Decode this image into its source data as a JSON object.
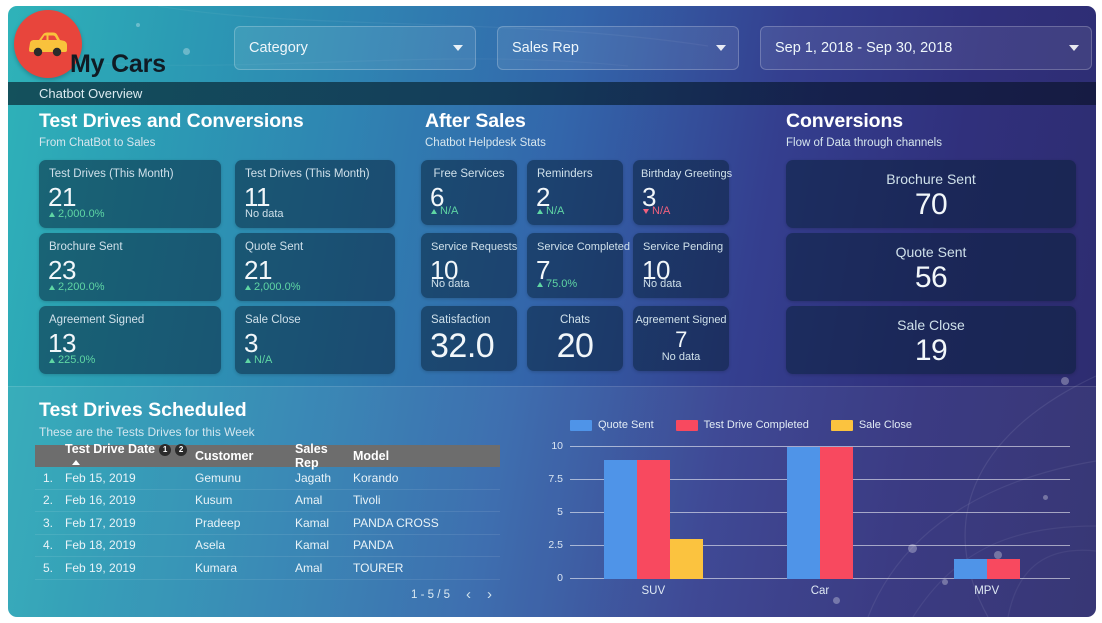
{
  "header": {
    "brand": "My Cars",
    "logo_icon": "car-icon",
    "subtitle": "Chatbot Overview",
    "filters": [
      {
        "name": "category",
        "label": "Category"
      },
      {
        "name": "sales-rep",
        "label": "Sales Rep"
      },
      {
        "name": "date-range",
        "label": "Sep 1, 2018 - Sep 30, 2018"
      }
    ]
  },
  "sections": {
    "test_drives": {
      "title": "Test Drives and Conversions",
      "subtitle": "From ChatBot to Sales",
      "cards": [
        {
          "label": "Test Drives (This Month)",
          "value": "21",
          "delta": "2,000.0%",
          "trend": "up"
        },
        {
          "label": "Test Drives (This Month)",
          "value": "11",
          "delta": "No data",
          "trend": "none"
        },
        {
          "label": "Brochure Sent",
          "value": "23",
          "delta": "2,200.0%",
          "trend": "up"
        },
        {
          "label": "Quote Sent",
          "value": "21",
          "delta": "2,000.0%",
          "trend": "up"
        },
        {
          "label": "Agreement Signed",
          "value": "13",
          "delta": "225.0%",
          "trend": "up"
        },
        {
          "label": "Sale Close",
          "value": "3",
          "delta": "N/A",
          "trend": "up"
        }
      ]
    },
    "after_sales": {
      "title": "After Sales",
      "subtitle": "Chatbot Helpdesk Stats",
      "cards": [
        {
          "label": "Free Services",
          "value": "6",
          "delta": "N/A",
          "trend": "up"
        },
        {
          "label": "Reminders",
          "value": "2",
          "delta": "N/A",
          "trend": "up"
        },
        {
          "label": "Birthday Greetings",
          "value": "3",
          "delta": "N/A",
          "trend": "down"
        },
        {
          "label": "Service Requests",
          "value": "10",
          "delta": "No data",
          "trend": "none"
        },
        {
          "label": "Service Completed",
          "value": "7",
          "delta": "75.0%",
          "trend": "up"
        },
        {
          "label": "Service Pending",
          "value": "10",
          "delta": "No data",
          "trend": "none"
        },
        {
          "label": "Satisfaction",
          "value": "32.0",
          "delta": "",
          "trend": "none"
        },
        {
          "label": "Chats",
          "value": "20",
          "delta": "",
          "trend": "none"
        },
        {
          "label": "Agreement Signed",
          "value": "7",
          "delta": "No data",
          "trend": "none"
        }
      ]
    },
    "conversions": {
      "title": "Conversions",
      "subtitle": "Flow of Data through channels",
      "cards": [
        {
          "label": "Brochure Sent",
          "value": "70"
        },
        {
          "label": "Quote Sent",
          "value": "56"
        },
        {
          "label": "Sale Close",
          "value": "19"
        }
      ]
    }
  },
  "bottom": {
    "title": "Test Drives Scheduled",
    "subtitle": "These are the Tests Drives for this Week",
    "table": {
      "columns": [
        "Test Drive Date",
        "Customer",
        "Sales Rep",
        "Model"
      ],
      "header_badges": [
        "1",
        "2"
      ],
      "rows": [
        {
          "idx": "1.",
          "date": "Feb 15, 2019",
          "customer": "Gemunu",
          "rep": "Jagath",
          "model": "Korando"
        },
        {
          "idx": "2.",
          "date": "Feb 16, 2019",
          "customer": "Kusum",
          "rep": "Amal",
          "model": "Tivoli"
        },
        {
          "idx": "3.",
          "date": "Feb 17, 2019",
          "customer": "Pradeep",
          "rep": "Kamal",
          "model": "PANDA CROSS"
        },
        {
          "idx": "4.",
          "date": "Feb 18, 2019",
          "customer": "Asela",
          "rep": "Kamal",
          "model": "PANDA"
        },
        {
          "idx": "5.",
          "date": "Feb 19, 2019",
          "customer": "Kumara",
          "rep": "Amal",
          "model": "TOURER"
        }
      ],
      "pagination": "1 - 5 / 5",
      "prev_icon": "chevron-left-icon",
      "next_icon": "chevron-right-icon"
    }
  },
  "chart_data": {
    "type": "bar",
    "title": "",
    "xlabel": "",
    "ylabel": "",
    "categories": [
      "SUV",
      "Car",
      "MPV"
    ],
    "series": [
      {
        "name": "Quote Sent",
        "color": "#4f94e8",
        "values": [
          9,
          10,
          1.5
        ]
      },
      {
        "name": "Test Drive Completed",
        "color": "#f8495f",
        "values": [
          9,
          10,
          1.5
        ]
      },
      {
        "name": "Sale Close",
        "color": "#fbc33f",
        "values": [
          3,
          0,
          0
        ]
      }
    ],
    "ylim": [
      0,
      10
    ],
    "yticks": [
      "0",
      "2.5",
      "5",
      "7.5",
      "10"
    ],
    "grid": true,
    "legend_position": "top"
  },
  "colors": {
    "accent_blue": "#4f94e8",
    "accent_red": "#f8495f",
    "accent_yellow": "#fbc33f",
    "logo_bg": "#e8453c",
    "logo_car": "#f9c23c",
    "up": "#5fd6a4",
    "down": "#f2617e"
  }
}
